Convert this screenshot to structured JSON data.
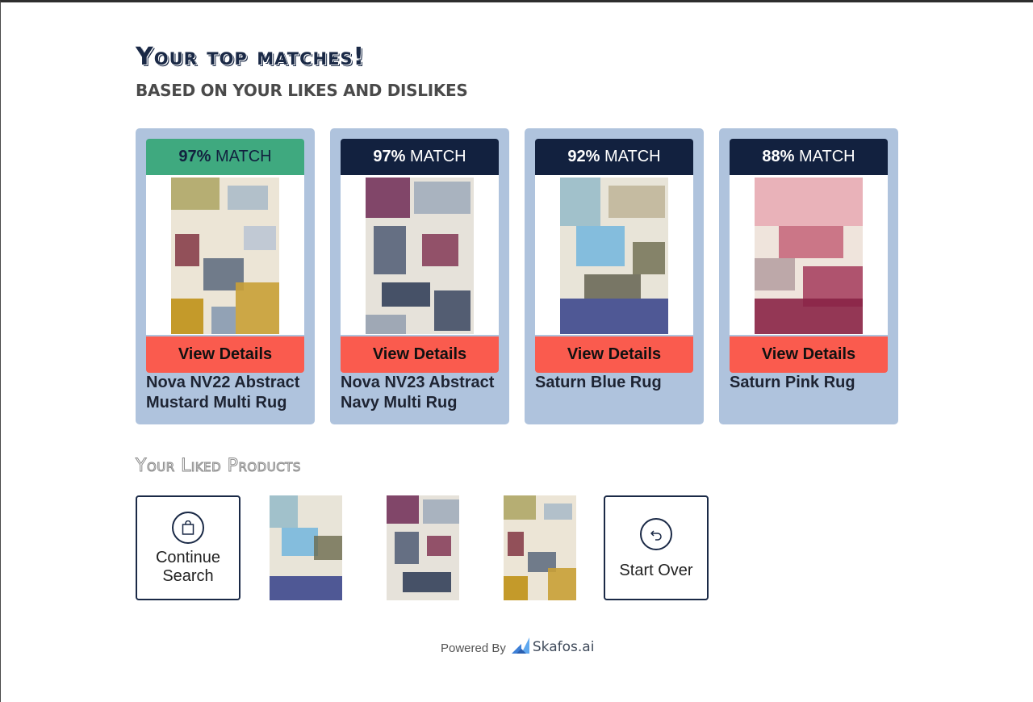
{
  "header": {
    "title": "Your top matches!",
    "subtitle": "BASED ON YOUR LIKES AND DISLIKES"
  },
  "colors": {
    "card_bg": "#afc3dd",
    "match_top": "#3fa97f",
    "match_default": "#12213f",
    "details_button": "#fa5b4e"
  },
  "matches": [
    {
      "percent": "97%",
      "match_label": "MATCH",
      "details_label": "View Details",
      "name": "Nova NV22 Abstract Mustard Multi Rug"
    },
    {
      "percent": "97%",
      "match_label": "MATCH",
      "details_label": "View Details",
      "name": "Nova NV23 Abstract Navy Multi Rug"
    },
    {
      "percent": "92%",
      "match_label": "MATCH",
      "details_label": "View Details",
      "name": "Saturn Blue Rug"
    },
    {
      "percent": "88%",
      "match_label": "MATCH",
      "details_label": "View Details",
      "name": "Saturn Pink Rug"
    }
  ],
  "liked": {
    "title": "Your Liked Products",
    "continue_label_1": "Continue",
    "continue_label_2": "Search",
    "continue_icon": "shopping-bag-icon",
    "start_over_label": "Start Over",
    "start_over_icon": "undo-arrow-icon"
  },
  "footer": {
    "powered_by": "Powered By",
    "brand": "Skafos.ai"
  }
}
